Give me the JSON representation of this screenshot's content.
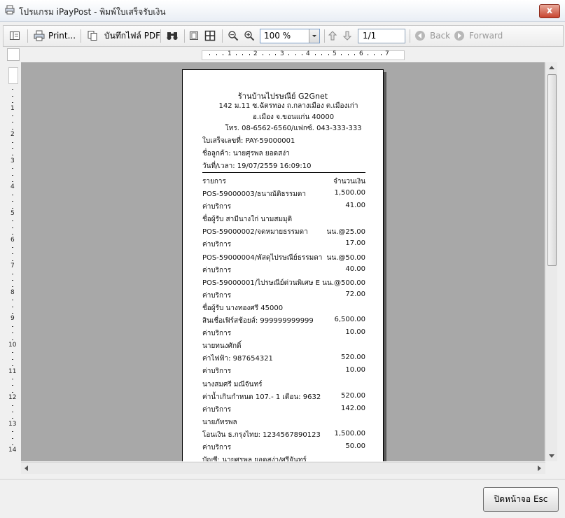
{
  "window": {
    "title": "โปรแกรม iPayPost - พิมพ์ใบเสร็จรับเงิน",
    "close_glyph": "x"
  },
  "toolbar": {
    "print_label": "Print...",
    "save_pdf_label": "บันทึกไฟล์ PDF",
    "zoom_value": "100 %",
    "page_value": "1/1",
    "back_label": "Back",
    "forward_label": "Forward"
  },
  "ruler": {
    "h_ticks": [
      "1",
      "2",
      "3",
      "4",
      "5",
      "6",
      "7"
    ],
    "v_ticks": [
      "1",
      "2",
      "3",
      "4",
      "5",
      "6",
      "7",
      "8",
      "9",
      "10",
      "11",
      "12",
      "13",
      "14"
    ]
  },
  "receipt": {
    "shop_name": "ร้านบ้านไปรษณีย์ G2Gnet",
    "address1": "142 ม.11 ซ.ฉัตรทอง ถ.กลางเมือง ต.เมืองเก่า",
    "address2": "อ.เมือง จ.ขอนแก่น 40000",
    "phone": "โทร. 08-6562-6560/แฟกซ์. 043-333-333",
    "receipt_no": "ใบเสร็จเลขที่: PAY-59000001",
    "customer": "ชื่อลูกค้า: นายศุรพล ยอดสง่า",
    "datetime": "วันที่/เวลา:  19/07/2559 16:09:10",
    "col_item": "รายการ",
    "col_amount": "จำนวนเงิน",
    "lines": [
      {
        "label": "POS-59000003/ธนาณัติธรรมดา",
        "amount": "1,500.00"
      },
      {
        "label": "ค่าบริการ",
        "amount": "41.00"
      },
      {
        "label": "ชื่อผู้รับ สามีนางใก่ นามสมมุติ",
        "amount": ""
      },
      {
        "label": "POS-59000002/จดหมายธรรมดา",
        "amount": "นน.@25.00"
      },
      {
        "label": "ค่าบริการ",
        "amount": "17.00"
      },
      {
        "label": "POS-59000004/พัสดุไปรษณีย์ธรรมดา",
        "amount": "นน.@50.00"
      },
      {
        "label": "ค่าบริการ",
        "amount": "40.00"
      },
      {
        "label": "POS-59000001/ไปรษณีย์ด่วนพิเศษ E",
        "amount": "นน.@500.00"
      },
      {
        "label": "ค่าบริการ",
        "amount": "72.00"
      },
      {
        "label": "ชื่อผู้รับ นางทองศรี 45000",
        "amount": ""
      },
      {
        "label": "สินเชื่อเฟิร์สช้อยส์: 999999999999",
        "amount": "6,500.00"
      },
      {
        "label": "ค่าบริการ",
        "amount": "10.00"
      },
      {
        "label": "นายทนงศักดิ์",
        "amount": ""
      },
      {
        "label": "ค่าไฟฟ้า: 987654321",
        "amount": "520.00"
      },
      {
        "label": "ค่าบริการ",
        "amount": "10.00"
      },
      {
        "label": "นางสมศรี มณีจันทร์",
        "amount": ""
      },
      {
        "label": "ค่าน้ำเกินกำหนด 107.- 1 เดือน: 9632",
        "amount": "520.00"
      },
      {
        "label": "ค่าบริการ",
        "amount": "142.00"
      },
      {
        "label": "นายภัทรพล",
        "amount": ""
      },
      {
        "label": "โอนเงิน ธ.กรุงไทย: 1234567890123",
        "amount": "1,500.00"
      },
      {
        "label": "ค่าบริการ",
        "amount": "50.00"
      },
      {
        "label": "บัญชี: นายศุรพล ยอดสง่า/ศรีจันทร์",
        "amount": ""
      }
    ]
  },
  "footer": {
    "close_button": "ปิดหน้าจอ Esc"
  }
}
